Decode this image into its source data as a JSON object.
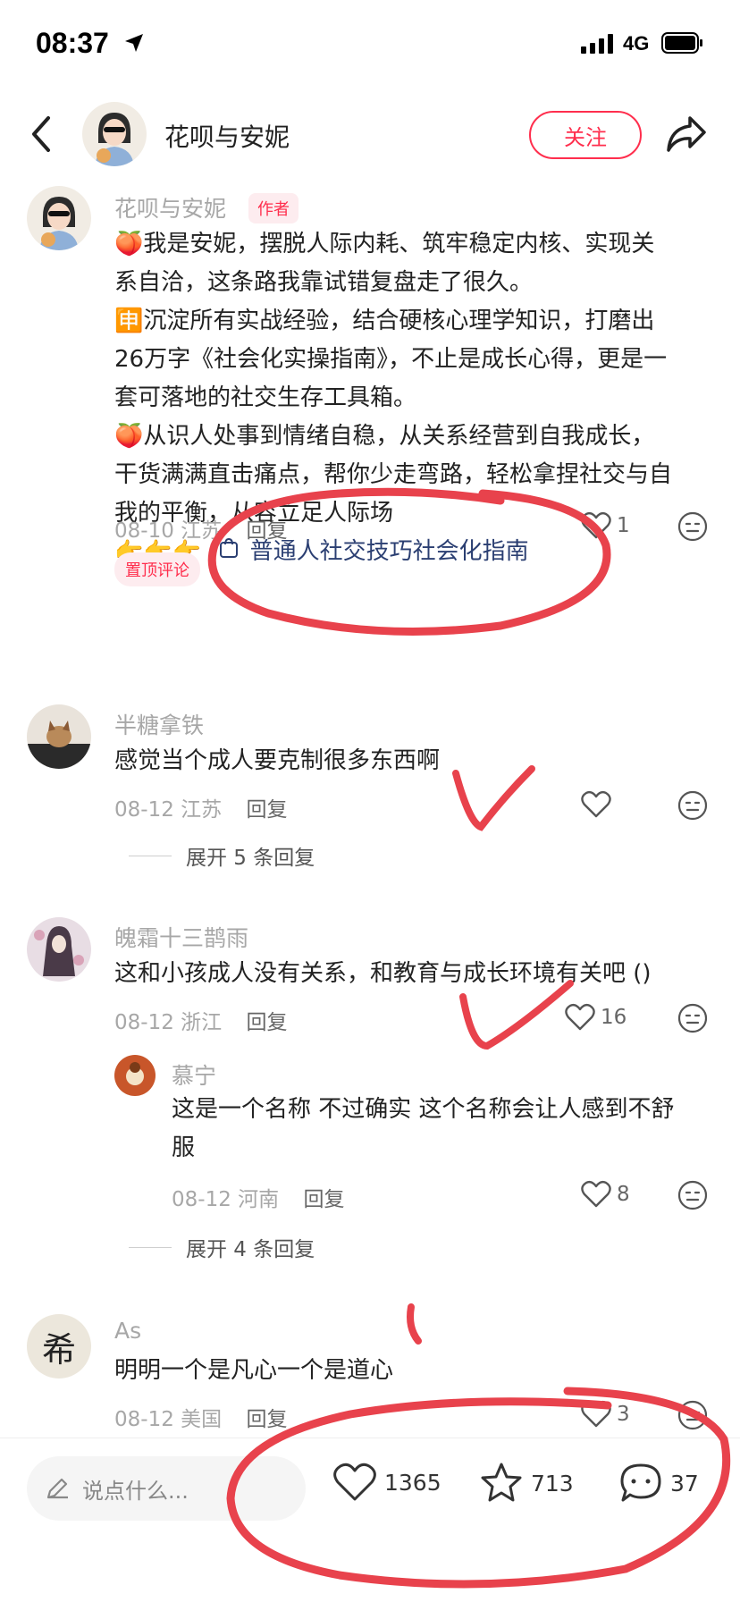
{
  "status": {
    "time": "08:37",
    "network": "4G"
  },
  "header": {
    "name": "花呗与安妮",
    "follow_label": "关注"
  },
  "comments": [
    {
      "name": "花呗与安妮",
      "tag": "作者",
      "lines": [
        "🍑我是安妮，摆脱人际内耗、筑牢稳定内核、实现关",
        "系自洽，这条路我靠试错复盘走了很久。",
        "🈸沉淀所有实战经验，结合硬核心理学知识，打磨出",
        "26万字《社会化实操指南》，不止是成长心得，更是一",
        "套可落地的社交生存工具箱。",
        "🍑从识人处事到情绪自稳，从关系经营到自我成长，",
        "干货满满直击痛点，帮你少走弯路，轻松拿捏社交与自",
        "我的平衡，从容立足人际场"
      ],
      "emoji_prefix": "👉👉👉",
      "link_text": "普通人社交技巧社会化指南",
      "date": "08-10",
      "location": "江苏",
      "reply_label": "回复",
      "likes": "1",
      "pinned_label": "置顶评论"
    },
    {
      "name": "半糖拿铁",
      "text": "感觉当个成人要克制很多东西啊",
      "date": "08-12",
      "location": "江苏",
      "reply_label": "回复",
      "likes": "",
      "expand_label": "展开 5 条回复"
    },
    {
      "name": "魄霜十三鹊雨",
      "text": "这和小孩成人没有关系，和教育与成长环境有关吧 ()",
      "date": "08-12",
      "location": "浙江",
      "reply_label": "回复",
      "likes": "16"
    },
    {
      "name": "慕宁",
      "lines": [
        "这是一个名称 不过确实 这个名称会让人感到不舒",
        "服"
      ],
      "date": "08-12",
      "location": "河南",
      "reply_label": "回复",
      "likes": "8",
      "expand_label": "展开 4 条回复"
    },
    {
      "name": "As",
      "avatar_char": "希",
      "text": "明明一个是凡心一个是道心",
      "date": "08-12",
      "location": "美国",
      "reply_label": "回复",
      "likes": "3"
    }
  ],
  "bottom": {
    "placeholder": "说点什么...",
    "likes": "1365",
    "favorites": "713",
    "comments": "37"
  },
  "colors": {
    "accent": "#ff2e4d",
    "annotation": "#e8424c",
    "link": "#2b3f72"
  }
}
